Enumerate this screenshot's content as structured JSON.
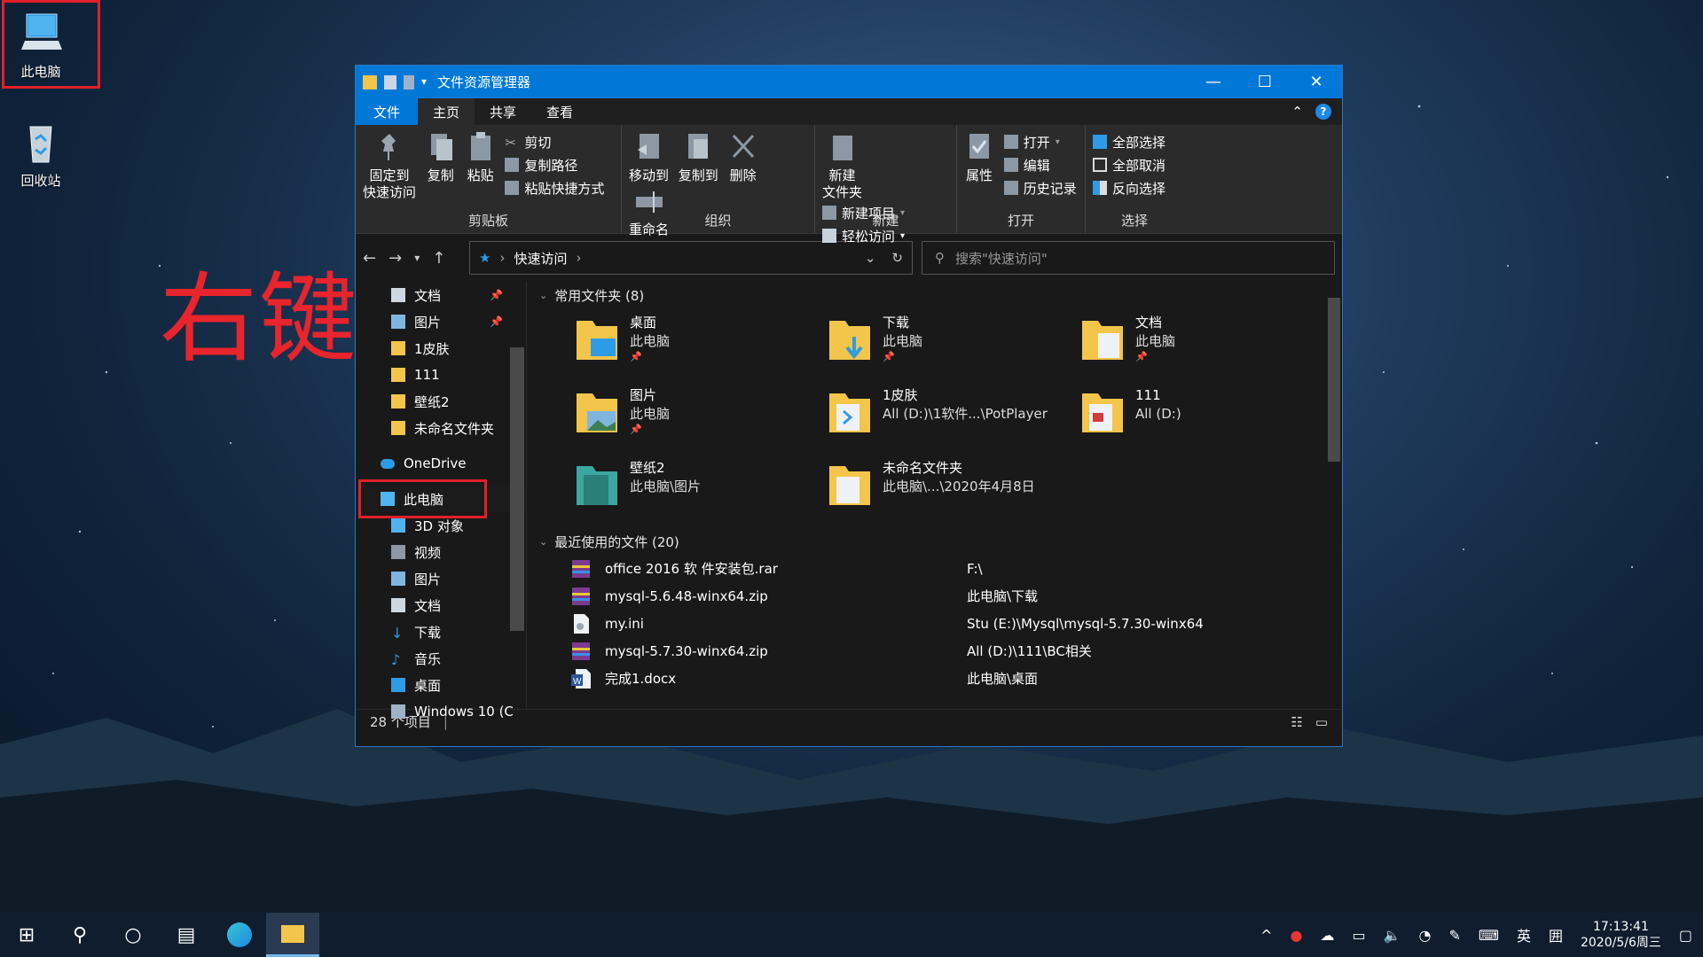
{
  "desktop": {
    "icons": [
      {
        "label": "此电脑",
        "icon": "computer-icon"
      },
      {
        "label": "回收站",
        "icon": "recycle-bin-icon"
      }
    ],
    "annotation_text": "右键"
  },
  "window": {
    "title": "文件资源管理器",
    "controls": {
      "minimize": "—",
      "maximize": "☐",
      "close": "✕"
    },
    "menu_tabs": [
      "文件",
      "主页",
      "共享",
      "查看"
    ],
    "ribbon": {
      "clipboard": {
        "label": "剪贴板",
        "pin": "固定到\n快速访问",
        "pin_l1": "固定到",
        "pin_l2": "快速访问",
        "copy": "复制",
        "paste": "粘贴",
        "cut": "剪切",
        "copy_path": "复制路径",
        "paste_shortcut": "粘贴快捷方式"
      },
      "organize": {
        "label": "组织",
        "move_to": "移动到",
        "copy_to": "复制到",
        "delete": "删除",
        "rename": "重命名"
      },
      "new": {
        "label": "新建",
        "new_folder_l1": "新建",
        "new_folder_l2": "文件夹",
        "new_item": "新建项目",
        "easy_access": "轻松访问"
      },
      "open": {
        "label": "打开",
        "properties": "属性",
        "open": "打开",
        "edit": "编辑",
        "history": "历史记录"
      },
      "select": {
        "label": "选择",
        "select_all": "全部选择",
        "select_none": "全部取消",
        "invert": "反向选择"
      }
    },
    "address": {
      "path": "快速访问"
    },
    "search": {
      "placeholder": "搜索\"快速访问\""
    },
    "nav_pane": {
      "quick_items": [
        {
          "label": "文档",
          "pinned": true
        },
        {
          "label": "图片",
          "pinned": true
        },
        {
          "label": "1皮肤",
          "pinned": false
        },
        {
          "label": "111",
          "pinned": false
        },
        {
          "label": "壁纸2",
          "pinned": false
        },
        {
          "label": "未命名文件夹",
          "pinned": false
        }
      ],
      "onedrive": "OneDrive",
      "this_pc": "此电脑",
      "pc_items": [
        "3D 对象",
        "视频",
        "图片",
        "文档",
        "下载",
        "音乐",
        "桌面",
        "Windows 10 (C"
      ]
    },
    "frequent": {
      "header": "常用文件夹 (8)",
      "items": [
        {
          "name": "桌面",
          "sub": "此电脑",
          "pin": "📌"
        },
        {
          "name": "下载",
          "sub": "此电脑",
          "pin": "📌"
        },
        {
          "name": "文档",
          "sub": "此电脑",
          "pin": "📌"
        },
        {
          "name": "图片",
          "sub": "此电脑",
          "pin": "📌"
        },
        {
          "name": "1皮肤",
          "sub": "All (D:)\\1软件...\\PotPlayer",
          "pin": ""
        },
        {
          "name": "111",
          "sub": "All (D:)",
          "pin": ""
        },
        {
          "name": "壁纸2",
          "sub": "此电脑\\图片",
          "pin": ""
        },
        {
          "name": "未命名文件夹",
          "sub": "此电脑\\...\\2020年4月8日",
          "pin": ""
        }
      ]
    },
    "recent": {
      "header": "最近使用的文件 (20)",
      "items": [
        {
          "name": "office 2016 软 件安装包.rar",
          "path": "F:\\"
        },
        {
          "name": "mysql-5.6.48-winx64.zip",
          "path": "此电脑\\下载"
        },
        {
          "name": "my.ini",
          "path": "Stu (E:)\\Mysql\\mysql-5.7.30-winx64"
        },
        {
          "name": "mysql-5.7.30-winx64.zip",
          "path": "All (D:)\\111\\BC相关"
        },
        {
          "name": "完成1.docx",
          "path": "此电脑\\桌面"
        }
      ]
    },
    "status": {
      "count": "28 个项目"
    }
  },
  "taskbar": {
    "clock_time": "17:13:41",
    "clock_date": "2020/5/6周三",
    "ime": "英",
    "ime2": "囲"
  },
  "colors": {
    "accent": "#0078d7",
    "highlight": "#e0202a",
    "folder": "#f3c54b"
  }
}
